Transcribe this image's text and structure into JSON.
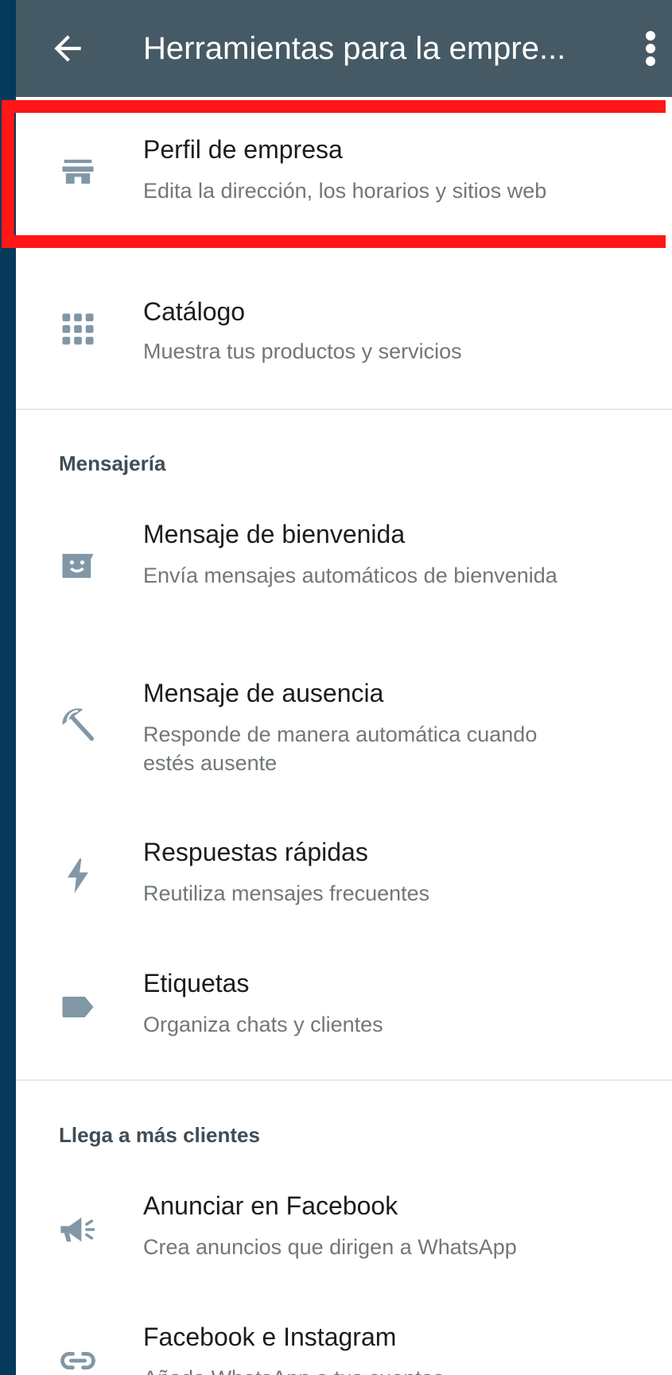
{
  "appbar": {
    "title": "Herramientas para la empre...",
    "back_icon": "arrow-back-icon",
    "more_icon": "more-vert-icon"
  },
  "items_top": [
    {
      "title": "Perfil de empresa",
      "subtitle": "Edita la dirección, los horarios y sitios web",
      "icon": "store-icon"
    },
    {
      "title": "Catálogo",
      "subtitle": "Muestra tus productos y servicios",
      "icon": "grid-icon"
    }
  ],
  "sections": [
    {
      "header": "Mensajería",
      "items": [
        {
          "title": "Mensaje de bienvenida",
          "subtitle": "Envía mensajes automáticos de bienvenida",
          "icon": "greeting-message-icon"
        },
        {
          "title": "Mensaje de ausencia",
          "subtitle": "Responde de manera automática cuando estés ausente",
          "icon": "beach-umbrella-icon"
        },
        {
          "title": "Respuestas rápidas",
          "subtitle": "Reutiliza mensajes frecuentes",
          "icon": "lightning-icon"
        },
        {
          "title": "Etiquetas",
          "subtitle": "Organiza chats y clientes",
          "icon": "label-icon"
        }
      ]
    },
    {
      "header": "Llega a más clientes",
      "items": [
        {
          "title": "Anunciar en Facebook",
          "subtitle": "Crea anuncios que dirigen a WhatsApp",
          "icon": "megaphone-icon"
        },
        {
          "title": "Facebook e Instagram",
          "subtitle": "Añade WhatsApp a tus cuentas",
          "icon": "link-icon"
        }
      ]
    }
  ],
  "colors": {
    "appbar": "#455a64",
    "icon": "#8197a6",
    "highlight": "#ff1616",
    "background": "#053a5c"
  }
}
